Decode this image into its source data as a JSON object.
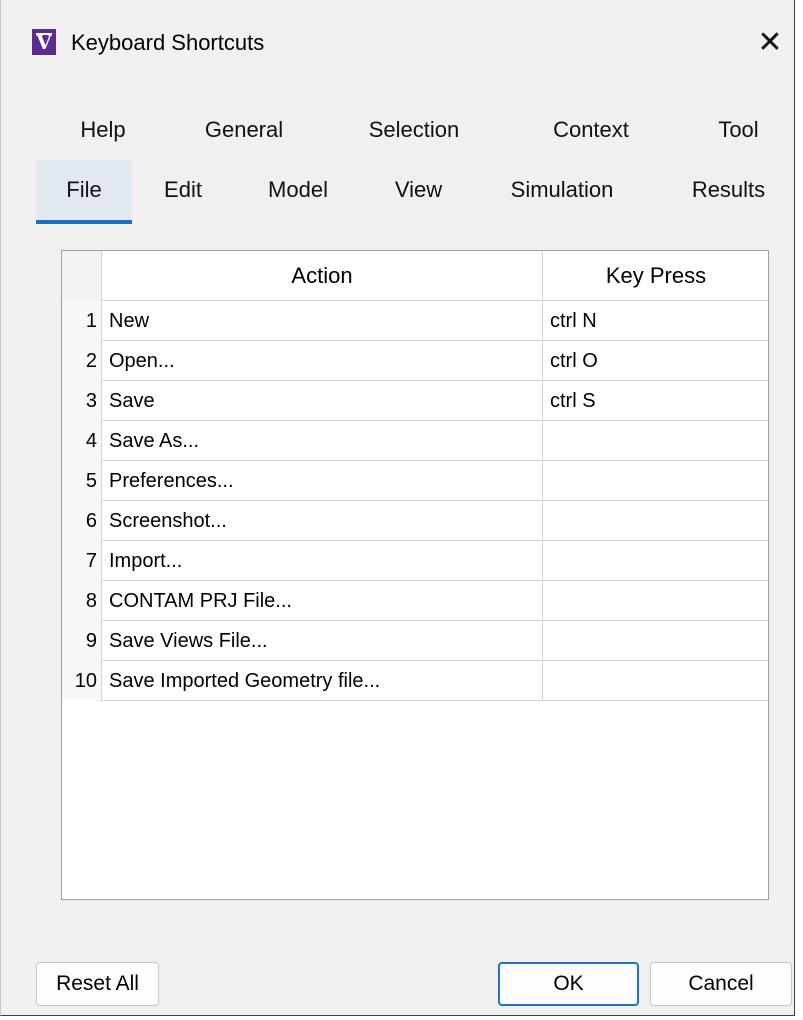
{
  "window": {
    "title": "Keyboard Shortcuts",
    "app_icon_glyph": "V",
    "close_glyph": "✕"
  },
  "tabs": {
    "row1": [
      {
        "label": "Help"
      },
      {
        "label": "General"
      },
      {
        "label": "Selection"
      },
      {
        "label": "Context"
      },
      {
        "label": "Tool"
      }
    ],
    "row2": [
      {
        "label": "File",
        "active": true
      },
      {
        "label": "Edit"
      },
      {
        "label": "Model"
      },
      {
        "label": "View"
      },
      {
        "label": "Simulation"
      },
      {
        "label": "Results"
      }
    ]
  },
  "table": {
    "columns": {
      "action": "Action",
      "key_press": "Key Press"
    },
    "rows": [
      {
        "num": "1",
        "action": "New",
        "key": "ctrl N"
      },
      {
        "num": "2",
        "action": "Open...",
        "key": "ctrl O"
      },
      {
        "num": "3",
        "action": "Save",
        "key": "ctrl S"
      },
      {
        "num": "4",
        "action": "Save As...",
        "key": ""
      },
      {
        "num": "5",
        "action": "Preferences...",
        "key": ""
      },
      {
        "num": "6",
        "action": "Screenshot...",
        "key": ""
      },
      {
        "num": "7",
        "action": "Import...",
        "key": ""
      },
      {
        "num": "8",
        "action": "CONTAM PRJ File...",
        "key": ""
      },
      {
        "num": "9",
        "action": "Save Views File...",
        "key": ""
      },
      {
        "num": "10",
        "action": "Save Imported Geometry file...",
        "key": ""
      }
    ]
  },
  "buttons": {
    "reset_all": "Reset All",
    "ok": "OK",
    "cancel": "Cancel"
  },
  "colors": {
    "app_icon": "#5b2d91",
    "active_tab_underline": "#1b6fc2",
    "ok_border": "#2173c9"
  }
}
